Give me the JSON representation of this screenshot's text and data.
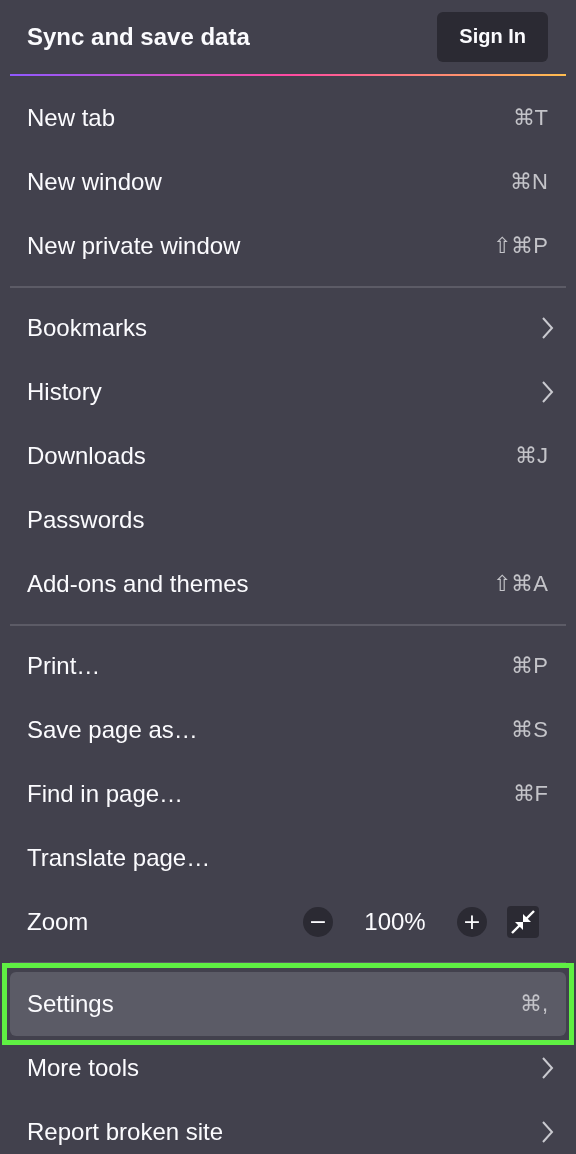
{
  "header": {
    "title": "Sync and save data",
    "button": "Sign In"
  },
  "items": [
    {
      "kind": "item",
      "label": "New tab",
      "shortcut": "⌘T"
    },
    {
      "kind": "item",
      "label": "New window",
      "shortcut": "⌘N"
    },
    {
      "kind": "item",
      "label": "New private window",
      "shortcut": "⇧⌘P"
    },
    {
      "kind": "separator"
    },
    {
      "kind": "item",
      "label": "Bookmarks",
      "submenu": true
    },
    {
      "kind": "item",
      "label": "History",
      "submenu": true
    },
    {
      "kind": "item",
      "label": "Downloads",
      "shortcut": "⌘J"
    },
    {
      "kind": "item",
      "label": "Passwords"
    },
    {
      "kind": "item",
      "label": "Add-ons and themes",
      "shortcut": "⇧⌘A"
    },
    {
      "kind": "separator"
    },
    {
      "kind": "item",
      "label": "Print…",
      "shortcut": "⌘P"
    },
    {
      "kind": "item",
      "label": "Save page as…",
      "shortcut": "⌘S"
    },
    {
      "kind": "item",
      "label": "Find in page…",
      "shortcut": "⌘F"
    },
    {
      "kind": "item",
      "label": "Translate page…"
    },
    {
      "kind": "zoom",
      "label": "Zoom",
      "minus": "−",
      "value": "100%",
      "plus": "+"
    },
    {
      "kind": "separator"
    },
    {
      "kind": "item",
      "label": "Settings",
      "shortcut": "⌘,",
      "selected": true,
      "highlighted": true
    },
    {
      "kind": "item",
      "label": "More tools",
      "submenu": true
    },
    {
      "kind": "item",
      "label": "Report broken site",
      "submenu": true
    }
  ]
}
